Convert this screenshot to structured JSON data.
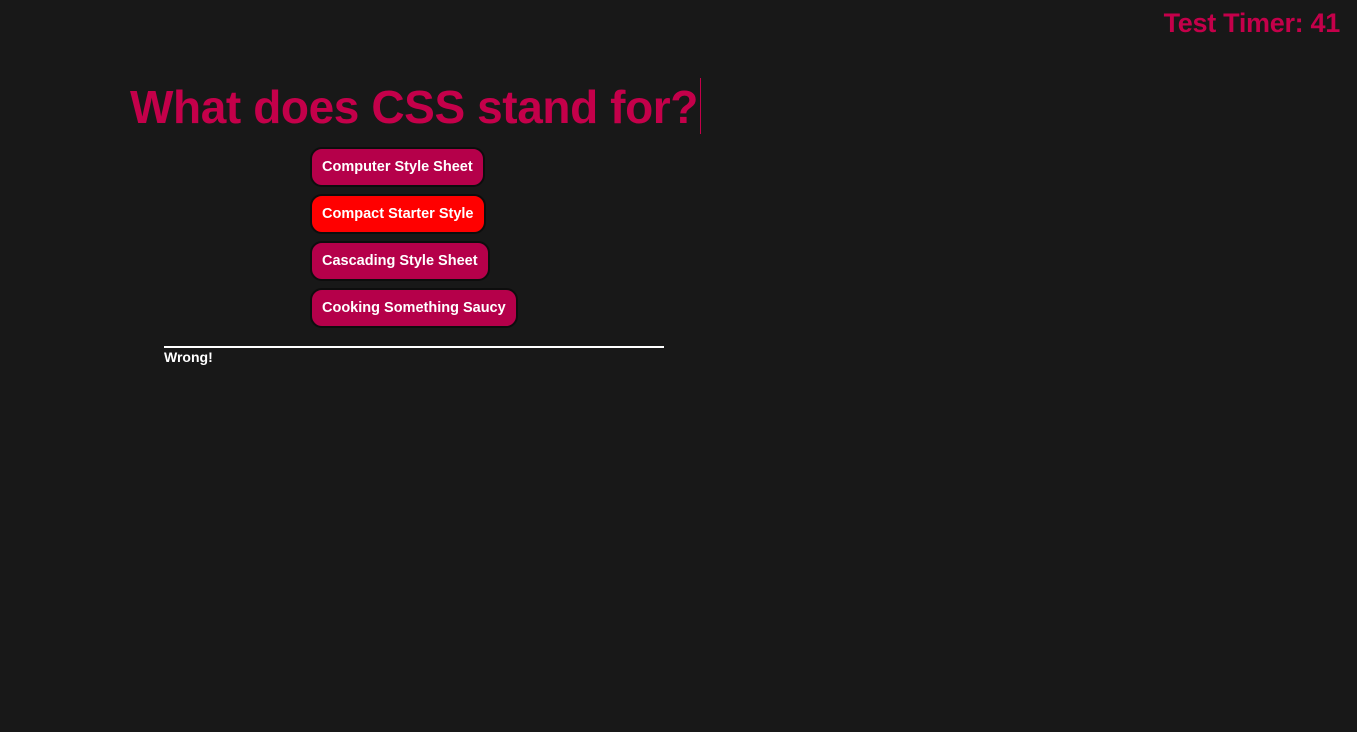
{
  "timer": {
    "label": "Test Timer: 41"
  },
  "quiz": {
    "question": "What does CSS stand for?",
    "answers": [
      {
        "label": "Computer Style Sheet",
        "state": "default"
      },
      {
        "label": "Compact Starter Style",
        "state": "wrong"
      },
      {
        "label": "Cascading Style Sheet",
        "state": "default"
      },
      {
        "label": "Cooking Something Saucy",
        "state": "default"
      }
    ],
    "feedback": "Wrong!"
  },
  "colors": {
    "background": "#181818",
    "accent": "#c4004a",
    "button": "#b5004a",
    "wrong": "#ff0000",
    "text": "#ffffff"
  }
}
